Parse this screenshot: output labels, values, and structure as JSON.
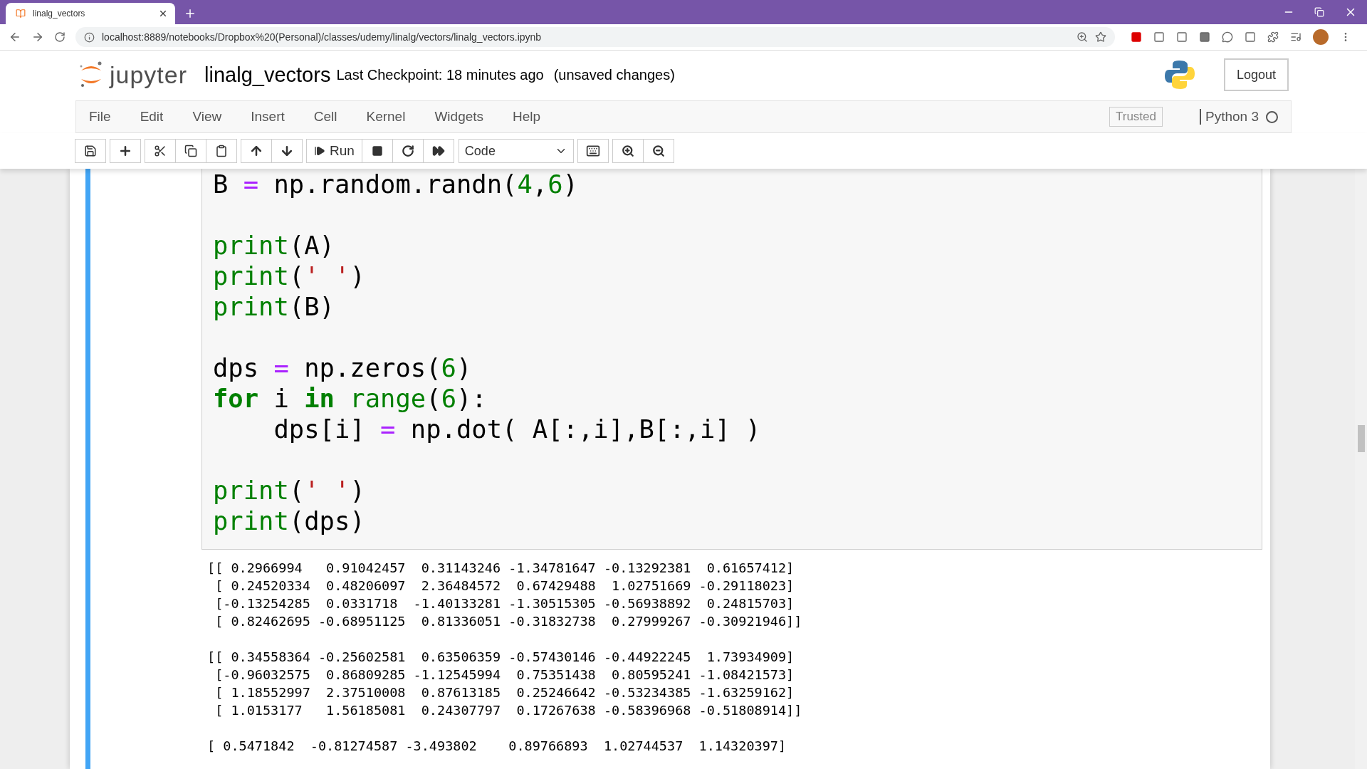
{
  "browser": {
    "tab_title": "linalg_vectors",
    "url": "localhost:8889/notebooks/Dropbox%20(Personal)/classes/udemy/linalg/vectors/linalg_vectors.ipynb"
  },
  "header": {
    "logo_text": "jupyter",
    "notebook_name": "linalg_vectors",
    "checkpoint": "Last Checkpoint: 18 minutes ago",
    "save_status": "(unsaved changes)",
    "logout": "Logout"
  },
  "menu": [
    "File",
    "Edit",
    "View",
    "Insert",
    "Cell",
    "Kernel",
    "Widgets",
    "Help"
  ],
  "trusted": "Trusted",
  "kernel": "Python 3",
  "toolbar": {
    "run_label": "Run",
    "cell_type": "Code"
  },
  "cell": {
    "code_blocks": [
      [
        [
          {
            "t": "B ",
            "kind": "plain"
          },
          {
            "t": "=",
            "kind": "op"
          },
          {
            "t": " np.random.randn(",
            "kind": "plain"
          },
          {
            "t": "4",
            "kind": "num"
          },
          {
            "t": ",",
            "kind": "plain"
          },
          {
            "t": "6",
            "kind": "num"
          },
          {
            "t": ")",
            "kind": "plain"
          }
        ]
      ],
      [
        [
          {
            "t": "print",
            "kind": "builtin"
          },
          {
            "t": "(A)",
            "kind": "plain"
          }
        ],
        [
          {
            "t": "print",
            "kind": "builtin"
          },
          {
            "t": "(",
            "kind": "plain"
          },
          {
            "t": "' '",
            "kind": "str"
          },
          {
            "t": ")",
            "kind": "plain"
          }
        ],
        [
          {
            "t": "print",
            "kind": "builtin"
          },
          {
            "t": "(B)",
            "kind": "plain"
          }
        ]
      ],
      [
        [
          {
            "t": "dps ",
            "kind": "plain"
          },
          {
            "t": "=",
            "kind": "op"
          },
          {
            "t": " np.zeros(",
            "kind": "plain"
          },
          {
            "t": "6",
            "kind": "num"
          },
          {
            "t": ")",
            "kind": "plain"
          }
        ],
        [
          {
            "t": "for",
            "kind": "keyword"
          },
          {
            "t": " i ",
            "kind": "plain"
          },
          {
            "t": "in",
            "kind": "keyword"
          },
          {
            "t": " range",
            "kind": "builtin"
          },
          {
            "t": "(",
            "kind": "plain"
          },
          {
            "t": "6",
            "kind": "num"
          },
          {
            "t": "):",
            "kind": "plain"
          }
        ],
        [
          {
            "t": "    dps[i] ",
            "kind": "plain"
          },
          {
            "t": "=",
            "kind": "op"
          },
          {
            "t": " np.dot( A[:,i],B[:,i] )",
            "kind": "plain"
          }
        ]
      ],
      [
        [
          {
            "t": "print",
            "kind": "builtin"
          },
          {
            "t": "(",
            "kind": "plain"
          },
          {
            "t": "' '",
            "kind": "str"
          },
          {
            "t": ")",
            "kind": "plain"
          }
        ],
        [
          {
            "t": "print",
            "kind": "builtin"
          },
          {
            "t": "(dps)",
            "kind": "plain"
          }
        ]
      ]
    ],
    "output_blocks": [
      [
        "[[ 0.2966994   0.91042457  0.31143246 -1.34781647 -0.13292381  0.61657412]",
        " [ 0.24520334  0.48206097  2.36484572  0.67429488  1.02751669 -0.29118023]",
        " [-0.13254285  0.0331718  -1.40133281 -1.30515305 -0.56938892  0.24815703]",
        " [ 0.82462695 -0.68951125  0.81336051 -0.31832738  0.27999267 -0.30921946]]"
      ],
      [
        "[[ 0.34558364 -0.25602581  0.63506359 -0.57430146 -0.44922245  1.73934909]",
        " [-0.96032575  0.86809285 -1.12545994  0.75351438  0.80595241 -1.08421573]",
        " [ 1.18552997  2.37510008  0.87613185  0.25246642 -0.53234385 -1.63259162]",
        " [ 1.0153177   1.56185081  0.24307797  0.17267638 -0.58396968 -0.51808914]]"
      ],
      [
        "[ 0.5471842  -0.81274587 -3.493802    0.89766893  1.02744537  1.14320397]"
      ]
    ]
  }
}
